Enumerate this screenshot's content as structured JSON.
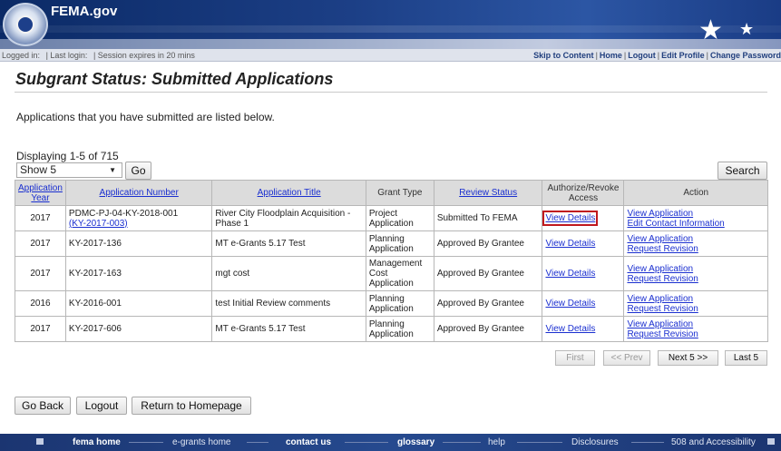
{
  "header": {
    "logo_text": "FEMA.gov"
  },
  "topbar": {
    "logged_in": "Logged in:",
    "last_login": "| Last login:",
    "session": "| Session expires in 20 mins",
    "links": [
      "Skip to Content",
      "Home",
      "Logout",
      "Edit Profile",
      "Change Password"
    ]
  },
  "page": {
    "title": "Subgrant Status: Submitted Applications",
    "intro": "Applications that you have submitted are listed below.",
    "displaying": "Displaying 1-5 of 715",
    "show_select": "Show 5",
    "go_label": "Go",
    "search_label": "Search"
  },
  "table": {
    "headers": [
      "Application Year",
      "Application Number",
      "Application Title",
      "Grant Type",
      "Review Status",
      "Authorize/Revoke Access",
      "Action"
    ],
    "rows": [
      {
        "year": "2017",
        "number": "PDMC-PJ-04-KY-2018-001",
        "number_link": "(KY-2017-003)",
        "title": "River City Floodplain Acquisition - Phase 1",
        "grant_type": "Project Application",
        "status": "Submitted To FEMA",
        "access": "View Details",
        "action1": "View Application",
        "action2": "Edit Contact Information"
      },
      {
        "year": "2017",
        "number": "KY-2017-136",
        "number_link": "",
        "title": "MT e-Grants 5.17 Test",
        "grant_type": "Planning Application",
        "status": "Approved By Grantee",
        "access": "View Details",
        "action1": "View Application",
        "action2": "Request Revision"
      },
      {
        "year": "2017",
        "number": "KY-2017-163",
        "number_link": "",
        "title": "mgt cost",
        "grant_type": "Management Cost Application",
        "status": "Approved By Grantee",
        "access": "View Details",
        "action1": "View Application",
        "action2": "Request Revision"
      },
      {
        "year": "2016",
        "number": "KY-2016-001",
        "number_link": "",
        "title": "test Initial Review comments",
        "grant_type": "Planning Application",
        "status": "Approved By Grantee",
        "access": "View Details",
        "action1": "View Application",
        "action2": "Request Revision"
      },
      {
        "year": "2017",
        "number": "KY-2017-606",
        "number_link": "",
        "title": "MT e-Grants 5.17 Test",
        "grant_type": "Planning Application",
        "status": "Approved By Grantee",
        "access": "View Details",
        "action1": "View Application",
        "action2": "Request Revision"
      }
    ]
  },
  "pagination": {
    "first": "First",
    "prev": "<< Prev",
    "next": "Next 5 >>",
    "last": "Last 5"
  },
  "bottom_buttons": {
    "back": "Go Back",
    "logout": "Logout",
    "home": "Return to Homepage"
  },
  "footer": {
    "links": [
      "fema home",
      "e-grants home",
      "contact us",
      "glossary",
      "help",
      "Disclosures",
      "508 and Accessibility"
    ]
  },
  "colors": {
    "header_blue": "#1c3f86",
    "link_blue": "#1a2fd0",
    "highlight_red": "#c0191e"
  }
}
